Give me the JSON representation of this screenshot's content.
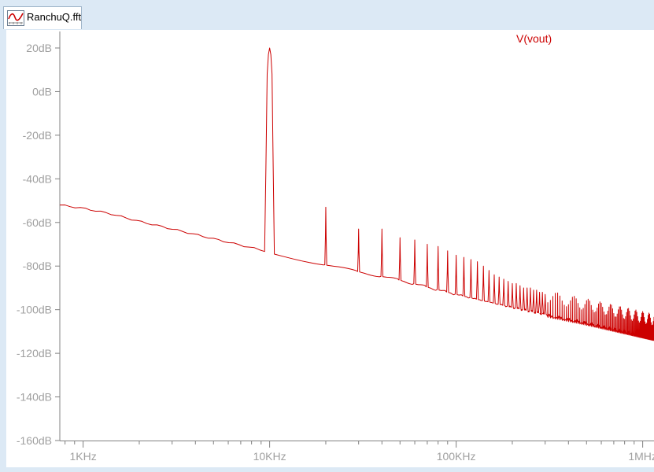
{
  "window": {
    "tab_title": "RanchuQ.fft",
    "tab_icon": "waveform-plot-icon"
  },
  "chart_data": {
    "type": "line",
    "title": "",
    "xlabel": "",
    "ylabel": "",
    "x_scale": "log",
    "xlim": [
      750,
      1150000
    ],
    "ylim": [
      -160,
      20
    ],
    "grid": false,
    "y_ticks": [
      20,
      0,
      -20,
      -40,
      -60,
      -80,
      -100,
      -120,
      -140,
      -160
    ],
    "y_tick_labels": [
      "20dB",
      "0dB",
      "-20dB",
      "-40dB",
      "-60dB",
      "-80dB",
      "-100dB",
      "-120dB",
      "-140dB",
      "-160dB"
    ],
    "x_ticks": [
      1000,
      10000,
      100000,
      1000000
    ],
    "x_tick_labels": [
      "1KHz",
      "10KHz",
      "100KHz",
      "1MHz"
    ],
    "colors": {
      "trace": "#cc0000",
      "axis": "#808080",
      "tick_text": "#a0a0a0"
    },
    "series": [
      {
        "name": "V(vout)",
        "noise_floor": [
          [
            750,
            -52
          ],
          [
            1000,
            -53.5
          ],
          [
            1400,
            -56
          ],
          [
            2000,
            -59.5
          ],
          [
            3000,
            -63
          ],
          [
            5000,
            -67.5
          ],
          [
            9400,
            -73
          ],
          [
            10600,
            -74.5
          ],
          [
            20000,
            -79.5
          ],
          [
            50000,
            -86.5
          ],
          [
            100000,
            -93
          ],
          [
            200000,
            -99
          ],
          [
            500000,
            -106
          ],
          [
            1150000,
            -113
          ]
        ],
        "harmonics_khz": [
          10,
          20,
          30,
          40,
          50,
          60,
          70,
          80,
          90,
          100,
          110,
          120,
          130,
          140,
          150,
          160,
          170,
          180,
          190,
          200,
          210,
          220,
          230,
          240,
          250,
          260,
          270,
          280,
          290,
          300
        ],
        "harmonic_peaks_db": [
          20,
          -53,
          -63,
          -63,
          -67,
          -68,
          -70,
          -71,
          -73,
          -75,
          -76,
          -77,
          -78,
          -80,
          -82,
          -84,
          -85,
          -86,
          -87,
          -88,
          -88,
          -89,
          -90,
          -90,
          -90,
          -91,
          -91,
          -92,
          -92,
          -93
        ],
        "fine_spur_region": {
          "start_hz": 300000,
          "end_hz": 1150000,
          "spacing_hz": 10000,
          "peak_above_floor_db": 11
        }
      }
    ]
  }
}
